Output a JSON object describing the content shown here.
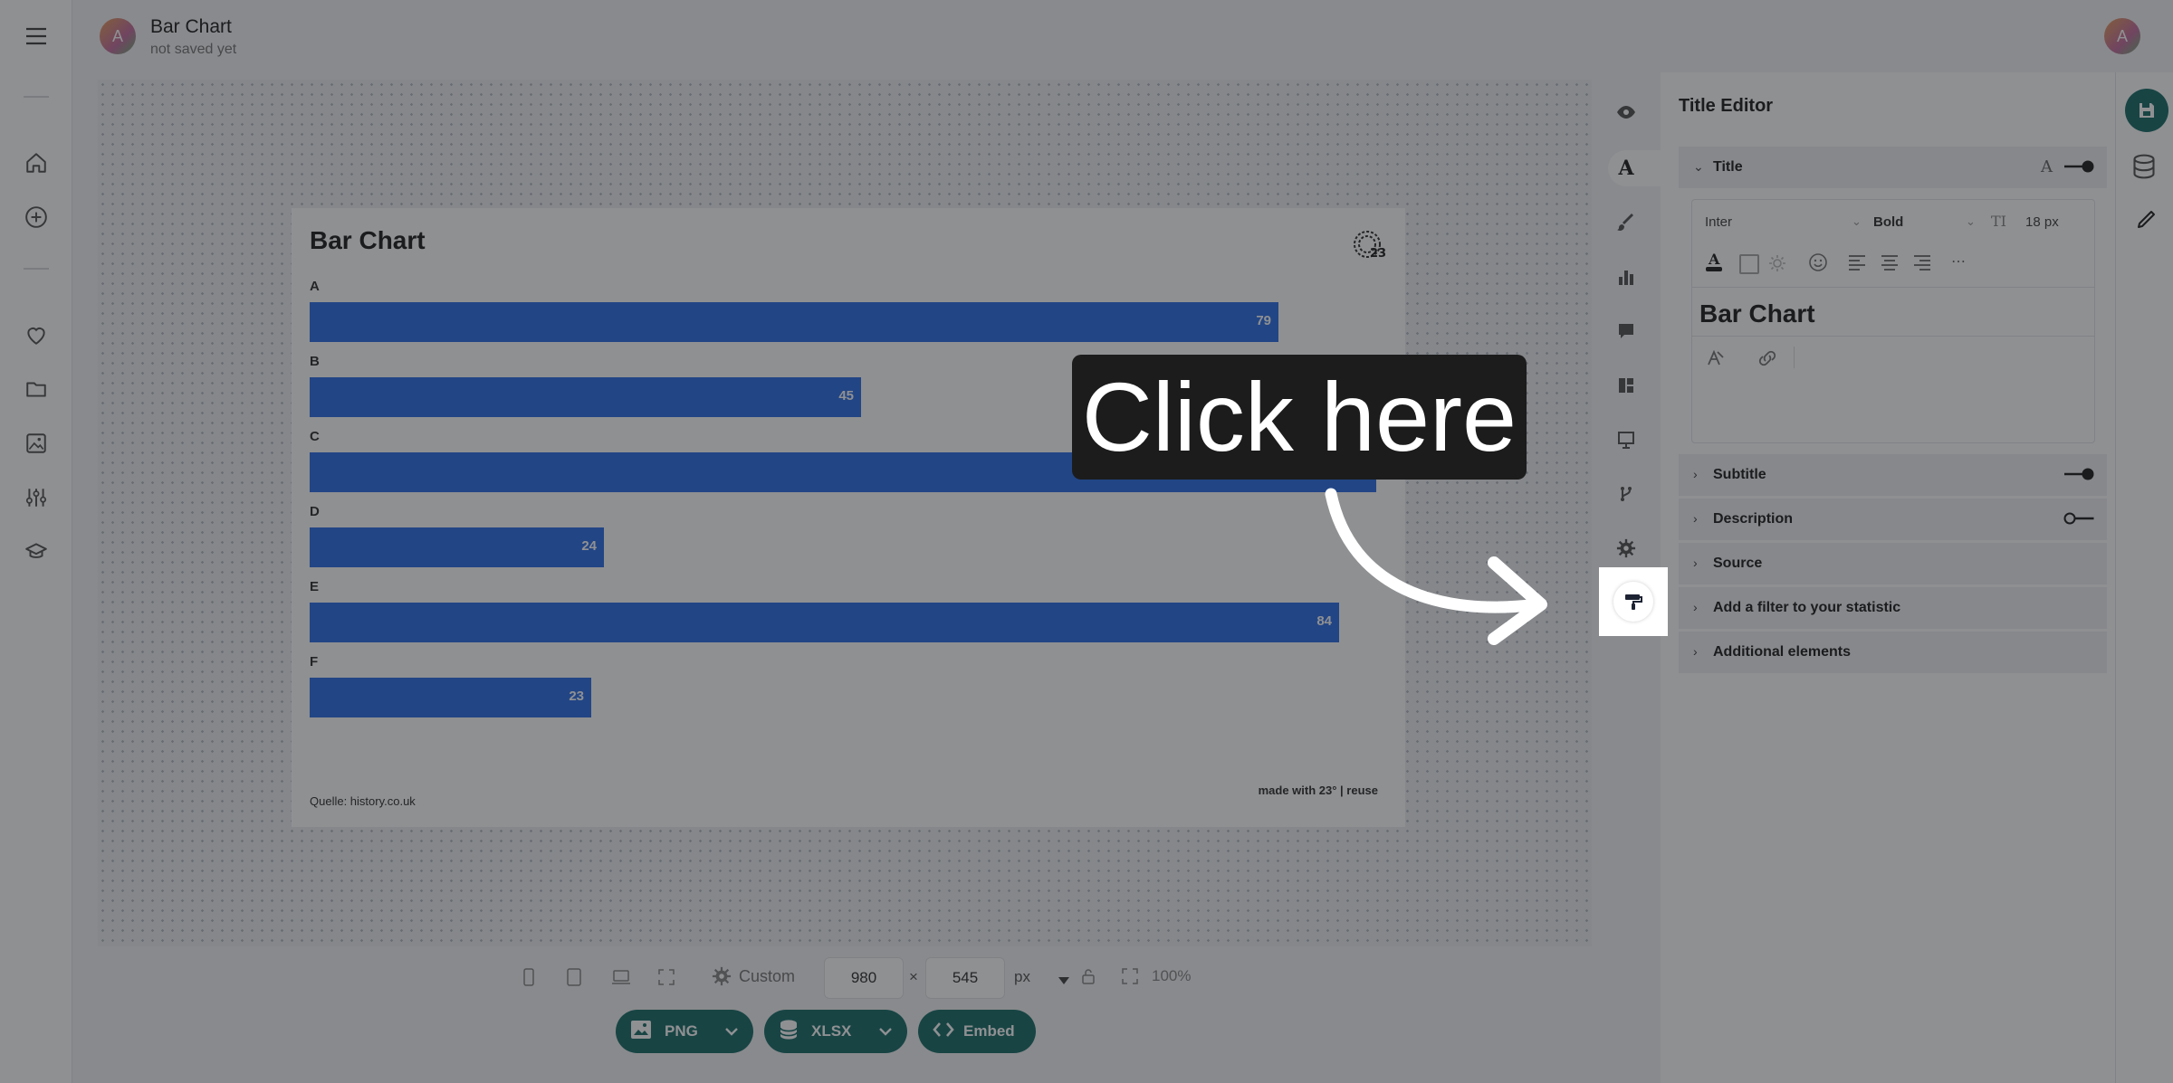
{
  "header": {
    "avatar_letter": "A",
    "title": "Bar Chart",
    "subtitle": "not saved yet",
    "user_letter": "A"
  },
  "chart": {
    "title": "Bar Chart",
    "source": "Quelle: history.co.uk",
    "footer": "made with 23° | reuse",
    "logo_text": "23°"
  },
  "chart_data": {
    "type": "bar",
    "orientation": "horizontal",
    "title": "Bar Chart",
    "categories": [
      "A",
      "B",
      "C",
      "D",
      "E",
      "F"
    ],
    "values": [
      79,
      45,
      87,
      24,
      84,
      23
    ],
    "xlim": [
      0,
      87
    ],
    "grid": false,
    "colors": {
      "bar": "#2f6fe6"
    }
  },
  "toolbar": {
    "preset": "Custom",
    "width": "980",
    "times": "×",
    "height": "545",
    "unit": "px",
    "zoom": "100%",
    "png_label": "PNG",
    "xlsx_label": "XLSX",
    "embed_label": "Embed"
  },
  "panel": {
    "heading": "Title Editor",
    "title_section": "Title",
    "font_family": "Inter",
    "font_weight": "Bold",
    "font_size": "18 px",
    "title_value": "Bar Chart",
    "sections": [
      "Subtitle",
      "Description",
      "Source",
      "Add a filter to your statistic",
      "Additional elements"
    ]
  },
  "callout": {
    "text": "Click here"
  },
  "colors": {
    "accent": "#1b6e6a",
    "bar": "#2f6fe6"
  }
}
